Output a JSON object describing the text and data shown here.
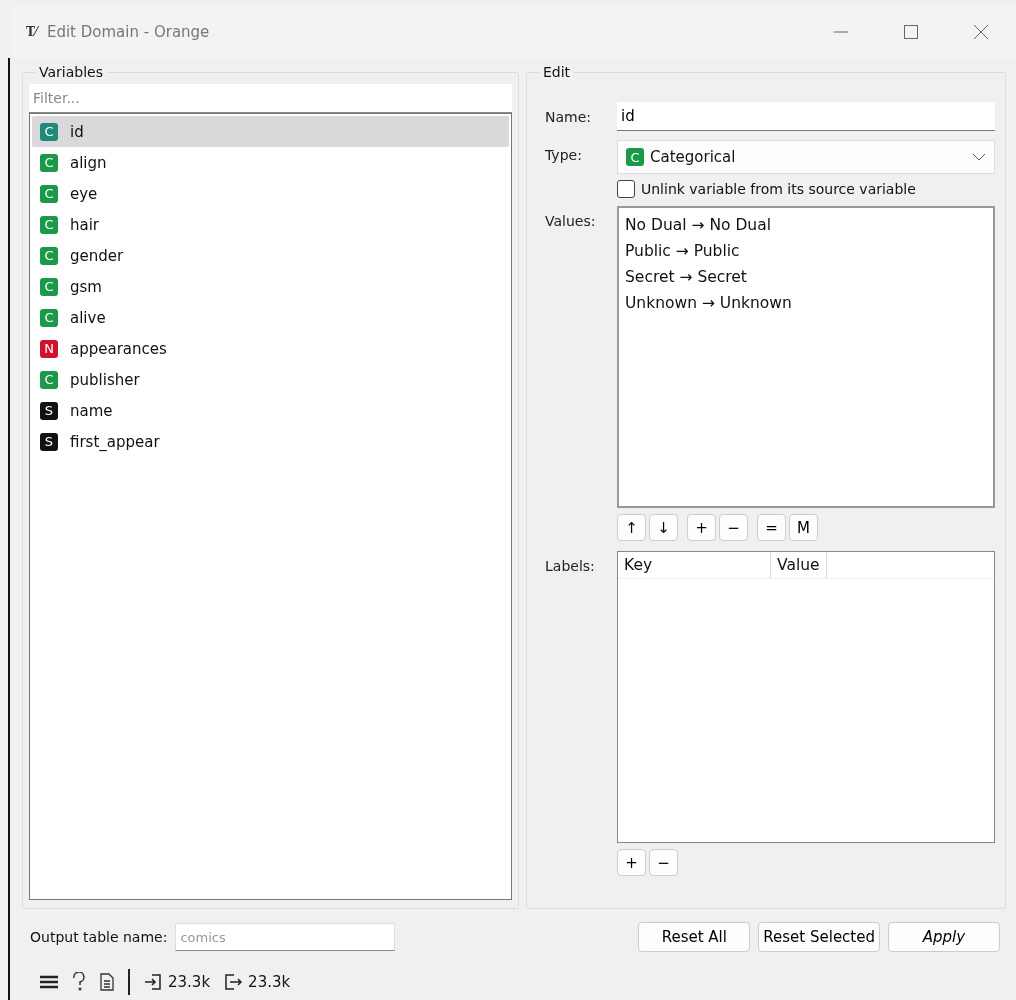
{
  "window": {
    "icon_text": "T⁄",
    "title": "Edit Domain - Orange"
  },
  "variables": {
    "legend": "Variables",
    "filter": {
      "placeholder": "Filter..."
    },
    "items": [
      {
        "kind": "categorical",
        "badge": "C",
        "name": "id",
        "selected": true
      },
      {
        "kind": "categorical",
        "badge": "C",
        "name": "align",
        "selected": false
      },
      {
        "kind": "categorical",
        "badge": "C",
        "name": "eye",
        "selected": false
      },
      {
        "kind": "categorical",
        "badge": "C",
        "name": "hair",
        "selected": false
      },
      {
        "kind": "categorical",
        "badge": "C",
        "name": "gender",
        "selected": false
      },
      {
        "kind": "categorical",
        "badge": "C",
        "name": "gsm",
        "selected": false
      },
      {
        "kind": "categorical",
        "badge": "C",
        "name": "alive",
        "selected": false
      },
      {
        "kind": "numeric",
        "badge": "N",
        "name": "appearances",
        "selected": false
      },
      {
        "kind": "categorical",
        "badge": "C",
        "name": "publisher",
        "selected": false
      },
      {
        "kind": "string",
        "badge": "S",
        "name": "name",
        "selected": false
      },
      {
        "kind": "string",
        "badge": "S",
        "name": "first_appear",
        "selected": false
      }
    ]
  },
  "edit": {
    "legend": "Edit",
    "name_label": "Name:",
    "name_value": "id",
    "type_label": "Type:",
    "type": {
      "kind": "categorical",
      "badge": "C",
      "label": "Categorical"
    },
    "unlink": {
      "label": "Unlink variable from its source variable",
      "checked": false
    },
    "values_label": "Values:",
    "values": [
      "No Dual → No Dual",
      "Public → Public",
      "Secret → Secret",
      "Unknown → Unknown"
    ],
    "value_button_groups": [
      [
        "↑",
        "↓"
      ],
      [
        "+",
        "−"
      ],
      [
        "=",
        "M"
      ]
    ],
    "labels_label": "Labels:",
    "labels_columns": [
      "Key",
      "Value"
    ],
    "label_buttons": [
      "+",
      "−"
    ]
  },
  "output": {
    "label": "Output table name:",
    "placeholder": "comics"
  },
  "buttons": [
    {
      "label": "Reset All",
      "italic": false
    },
    {
      "label": "Reset Selected",
      "italic": false
    },
    {
      "label": "Apply",
      "italic": true
    }
  ],
  "status_bar": {
    "input_count": "23.3k",
    "output_count": "23.3k"
  }
}
